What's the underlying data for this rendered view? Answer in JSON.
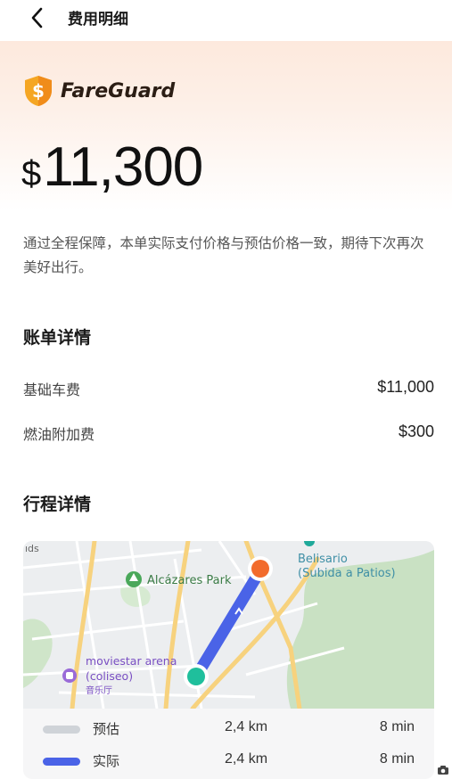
{
  "header": {
    "title": "费用明细",
    "back_icon": "chevron-left-icon"
  },
  "brand": {
    "name": "FareGuard",
    "icon": "dollar-shield-icon",
    "icon_color": "#f5a623"
  },
  "fare": {
    "currency": "$",
    "amount": "11,300"
  },
  "note": "通过全程保障，本单实际支付价格与预估价格一致，期待下次再次美好出行。",
  "bill": {
    "title": "账单详情",
    "items": [
      {
        "label": "基础车费",
        "value": "$11,000"
      },
      {
        "label": "燃油附加费",
        "value": "$300"
      }
    ]
  },
  "trip": {
    "title": "行程详情",
    "map_labels": {
      "corner": "ıds",
      "park": "Alcázares Park",
      "place_1": "Belisario",
      "place_2": "(Subida a Patios)",
      "arena_1": "moviestar arena",
      "arena_2": "(coliseo)",
      "arena_3": "音乐厅"
    },
    "route_color": "#4a63e7",
    "start_color": "#1fbf9c",
    "end_color": "#f26b2c",
    "legend": [
      {
        "label": "预估",
        "distance": "2,4 km",
        "time": "8 min",
        "color": "#cfd3d8"
      },
      {
        "label": "实际",
        "distance": "2,4 km",
        "time": "8 min",
        "color": "#4a63e7"
      }
    ]
  }
}
